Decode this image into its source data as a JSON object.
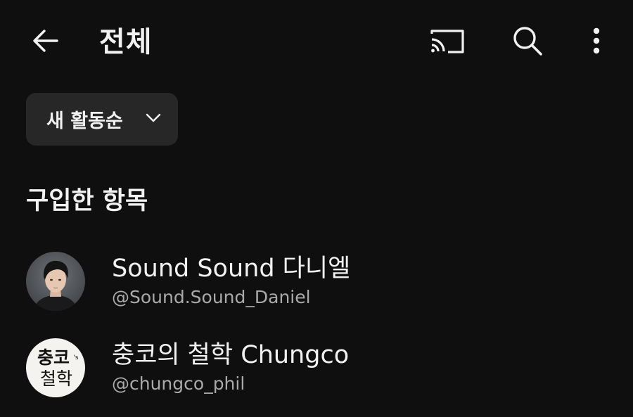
{
  "header": {
    "title": "전체",
    "back_icon": "arrow-left-icon",
    "cast_icon": "cast-icon",
    "search_icon": "search-icon",
    "more_icon": "more-vert-icon"
  },
  "sort": {
    "label": "새 활동순",
    "icon": "chevron-down-icon"
  },
  "section": {
    "title": "구입한 항목"
  },
  "channels": [
    {
      "name": "Sound Sound 다니엘",
      "handle": "@Sound.Sound_Daniel",
      "avatar": "profile-photo"
    },
    {
      "name": "충코의 철학 Chungco",
      "handle": "@chungco_phil",
      "avatar": "logo",
      "logo_text_top": "충코",
      "logo_text_small": "'s",
      "logo_text_bottom": "철학"
    }
  ],
  "colors": {
    "background": "#0f0f0f",
    "chip": "#272727",
    "text_primary": "#f1f1f1",
    "text_secondary": "#aaaaaa"
  }
}
